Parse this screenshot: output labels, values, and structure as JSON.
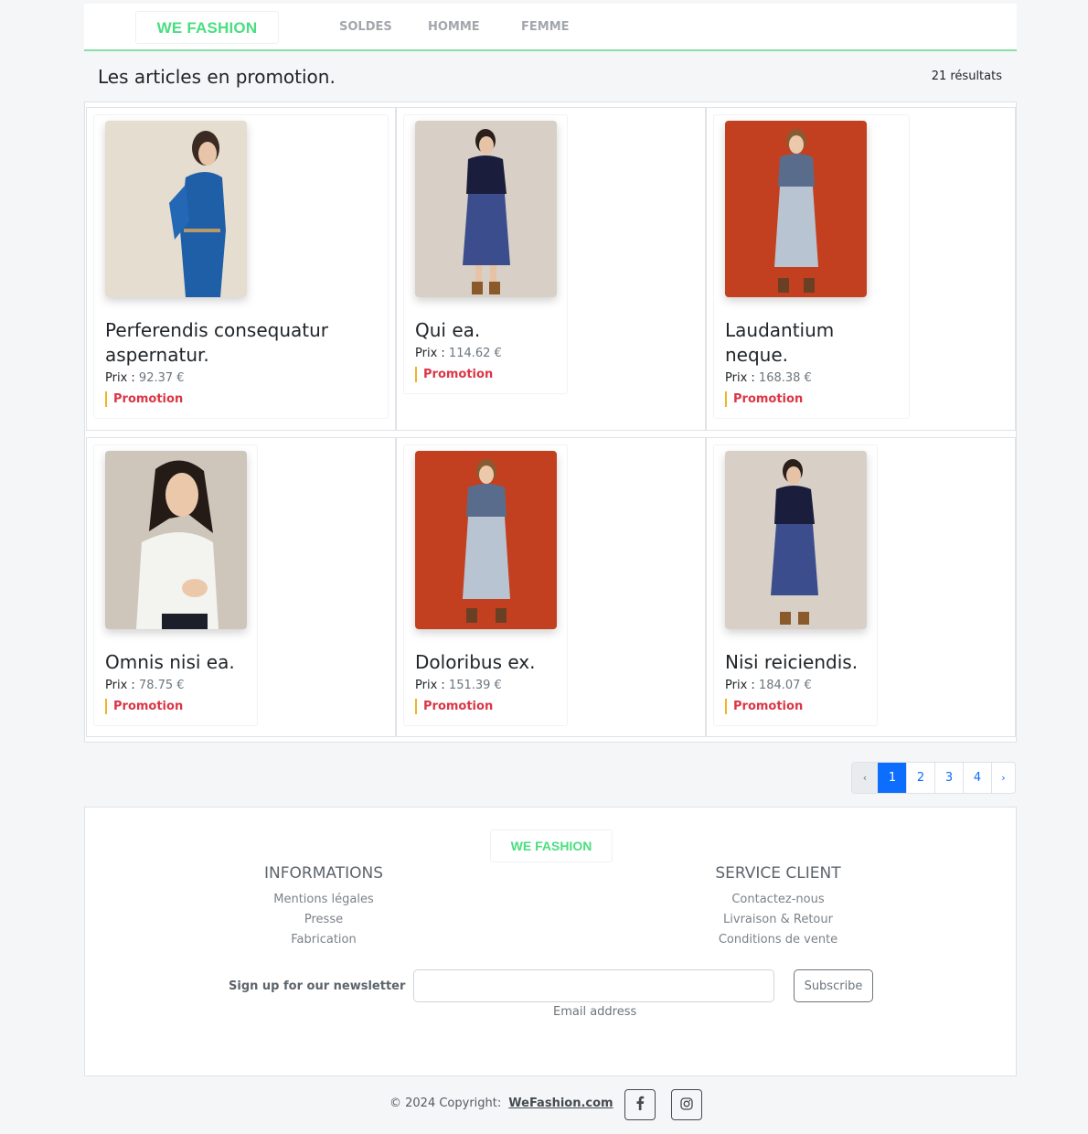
{
  "navbar": {
    "brand": "WE FASHION",
    "links": [
      "SOLDES",
      "HOMME",
      "FEMME"
    ]
  },
  "header": {
    "title": "Les articles en promotion.",
    "count": "21 résultats"
  },
  "products": [
    {
      "name": "Perferendis consequatur aspernatur.",
      "price_label": "Prix :",
      "price": "92.37 €",
      "badge": "Promotion"
    },
    {
      "name": "Qui ea.",
      "price_label": "Prix :",
      "price": "114.62 €",
      "badge": "Promotion"
    },
    {
      "name": "Laudantium neque.",
      "price_label": "Prix :",
      "price": "168.38 €",
      "badge": "Promotion"
    },
    {
      "name": "Omnis nisi ea.",
      "price_label": "Prix :",
      "price": "78.75 €",
      "badge": "Promotion"
    },
    {
      "name": "Doloribus ex.",
      "price_label": "Prix :",
      "price": "151.39 €",
      "badge": "Promotion"
    },
    {
      "name": "Nisi reiciendis.",
      "price_label": "Prix :",
      "price": "184.07 €",
      "badge": "Promotion"
    }
  ],
  "pagination": {
    "prev": "‹",
    "pages": [
      "1",
      "2",
      "3",
      "4"
    ],
    "current": "1",
    "next": "›"
  },
  "footer": {
    "brand": "WE FASHION",
    "informations": {
      "title": "INFORMATIONS",
      "links": [
        "Mentions légales",
        "Presse",
        "Fabrication"
      ]
    },
    "service": {
      "title": "SERVICE CLIENT",
      "links": [
        "Contactez-nous",
        "Livraison & Retour",
        "Conditions de vente"
      ]
    },
    "newsletter": {
      "label": "Sign up for our newsletter",
      "value": "",
      "help": "Email address",
      "button": "Subscribe"
    },
    "copyright": "© 2024 Copyright:",
    "site": "WeFashion.com",
    "social": [
      "facebook-icon",
      "instagram-icon"
    ]
  },
  "colors": {
    "brand": "#4ade80",
    "promo": "#dc3545",
    "promo_bar": "#f0b429",
    "active_page": "#0d6efd"
  }
}
